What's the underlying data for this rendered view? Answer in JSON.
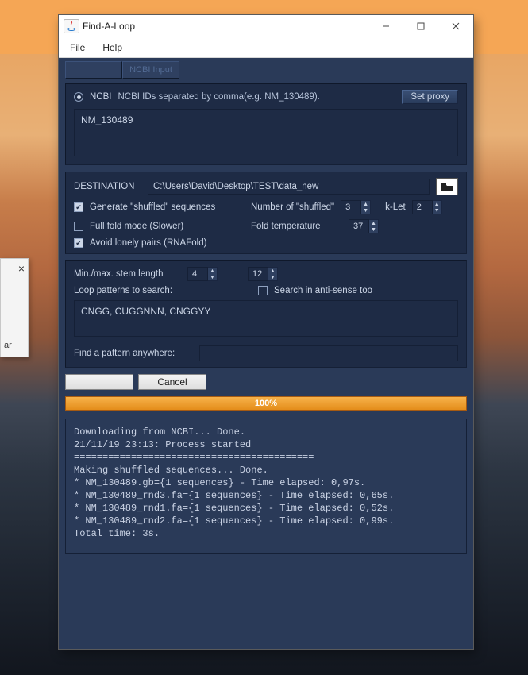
{
  "window": {
    "title": "Find-A-Loop"
  },
  "menu": {
    "file": "File",
    "help": "Help"
  },
  "tabs": {
    "blank": " ",
    "active": "NCBI Input"
  },
  "source": {
    "ncbi_label": "NCBI",
    "ncbi_hint": "NCBI IDs separated by comma(e.g. NM_130489).",
    "set_proxy": "Set proxy",
    "ids": "NM_130489"
  },
  "dest": {
    "label": "DESTINATION",
    "path": "C:\\Users\\David\\Desktop\\TEST\\data_new",
    "gen_shuffled": "Generate \"shuffled\" sequences",
    "num_shuffled": "Number of \"shuffled\"",
    "num_shuffled_val": "3",
    "klet": "k-Let",
    "klet_val": "2",
    "full_fold": "Full fold mode (Slower)",
    "fold_temp": "Fold temperature",
    "fold_temp_val": "37",
    "avoid_lonely": "Avoid lonely pairs (RNAFold)"
  },
  "stem": {
    "min_max": "Min./max. stem length",
    "min_val": "4",
    "max_val": "12",
    "loop_label": "Loop patterns to search:",
    "anti_sense": "Search in anti-sense too",
    "patterns": "CNGG, CUGGNNN, CNGGYY",
    "find_anywhere": "Find a pattern anywhere:",
    "find_value": ""
  },
  "ctrl": {
    "cancel": "Cancel",
    "progress": "100%"
  },
  "log_text": "Downloading from NCBI... Done.\n21/11/19 23:13: Process started\n==========================================\nMaking shuffled sequences... Done.\n* NM_130489.gb={1 sequences} - Time elapsed: 0,97s.\n* NM_130489_rnd3.fa={1 sequences} - Time elapsed: 0,65s.\n* NM_130489_rnd1.fa={1 sequences} - Time elapsed: 0,52s.\n* NM_130489_rnd2.fa={1 sequences} - Time elapsed: 0,99s.\nTotal time: 3s."
}
